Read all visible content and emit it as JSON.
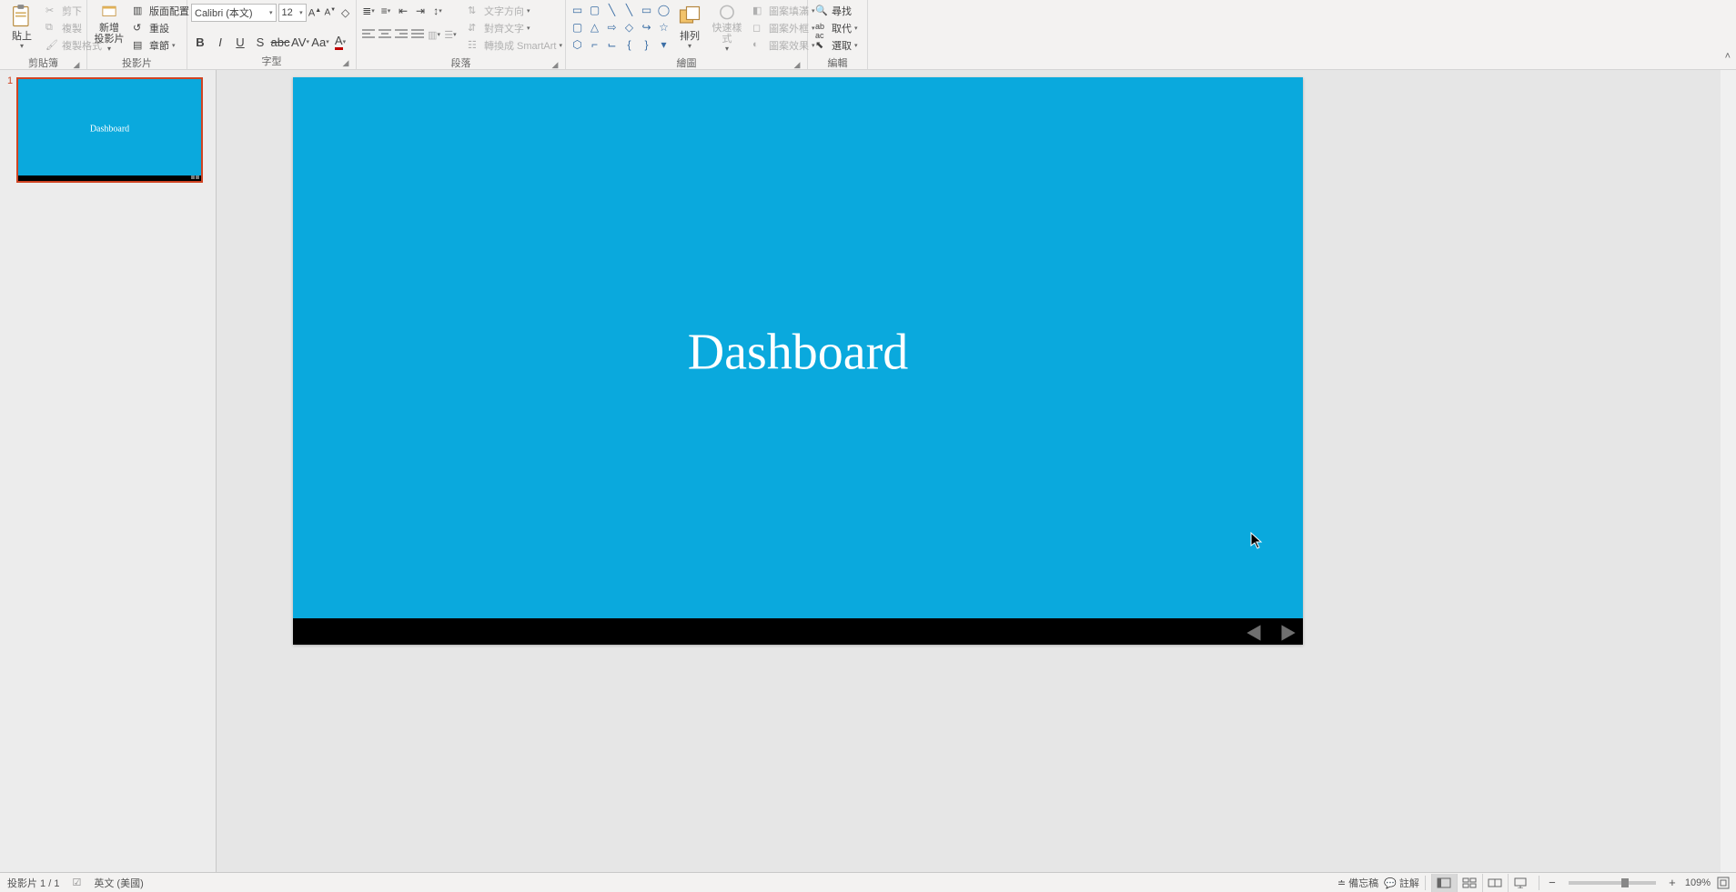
{
  "ribbon": {
    "clipboard": {
      "paste": "貼上",
      "cut": "剪下",
      "copy": "複製",
      "format_painter": "複製格式",
      "group_label": "剪貼簿"
    },
    "slides": {
      "new_slide": "新增\n投影片",
      "layout": "版面配置",
      "reset": "重設",
      "section": "章節",
      "group_label": "投影片"
    },
    "font": {
      "name": "Calibri (本文)",
      "size": "12",
      "group_label": "字型"
    },
    "paragraph": {
      "text_direction": "文字方向",
      "align_text": "對齊文字",
      "smartart": "轉換成 SmartArt",
      "group_label": "段落"
    },
    "drawing": {
      "arrange": "排列",
      "quick_styles": "快速樣式",
      "shape_fill": "圖案填滿",
      "shape_outline": "圖案外框",
      "shape_effects": "圖案效果",
      "group_label": "繪圖"
    },
    "editing": {
      "find": "尋找",
      "replace": "取代",
      "select": "選取",
      "group_label": "編輯"
    }
  },
  "slide": {
    "title": "Dashboard",
    "number": "1"
  },
  "statusbar": {
    "slide_pos": "投影片 1 / 1",
    "language": "英文 (美國)",
    "notes": "備忘稿",
    "comments": "註解",
    "zoom": "109%"
  }
}
